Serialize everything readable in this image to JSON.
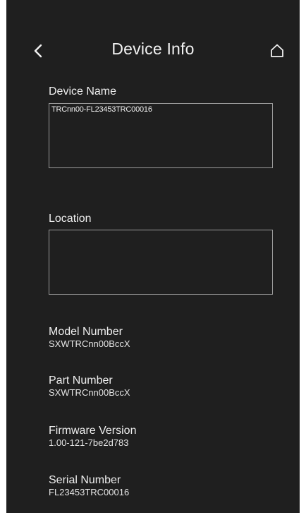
{
  "header": {
    "title": "Device Info",
    "back_icon": "chevron-left-icon",
    "home_icon": "home-icon"
  },
  "device_name": {
    "label": "Device Name",
    "value": "TRCnn00-FL23453TRC00016"
  },
  "location": {
    "label": "Location",
    "value": ""
  },
  "model_number": {
    "label": "Model Number",
    "value": "SXWTRCnn00BccX"
  },
  "part_number": {
    "label": "Part Number",
    "value": "SXWTRCnn00BccX"
  },
  "firmware_version": {
    "label": "Firmware Version",
    "value": "1.00-121-7be2d783"
  },
  "serial_number": {
    "label": "Serial Number",
    "value": "FL23453TRC00016"
  },
  "colors": {
    "background": "#1f1f1f",
    "text": "#f0f0f0",
    "field_border": "#9a9a9a"
  }
}
